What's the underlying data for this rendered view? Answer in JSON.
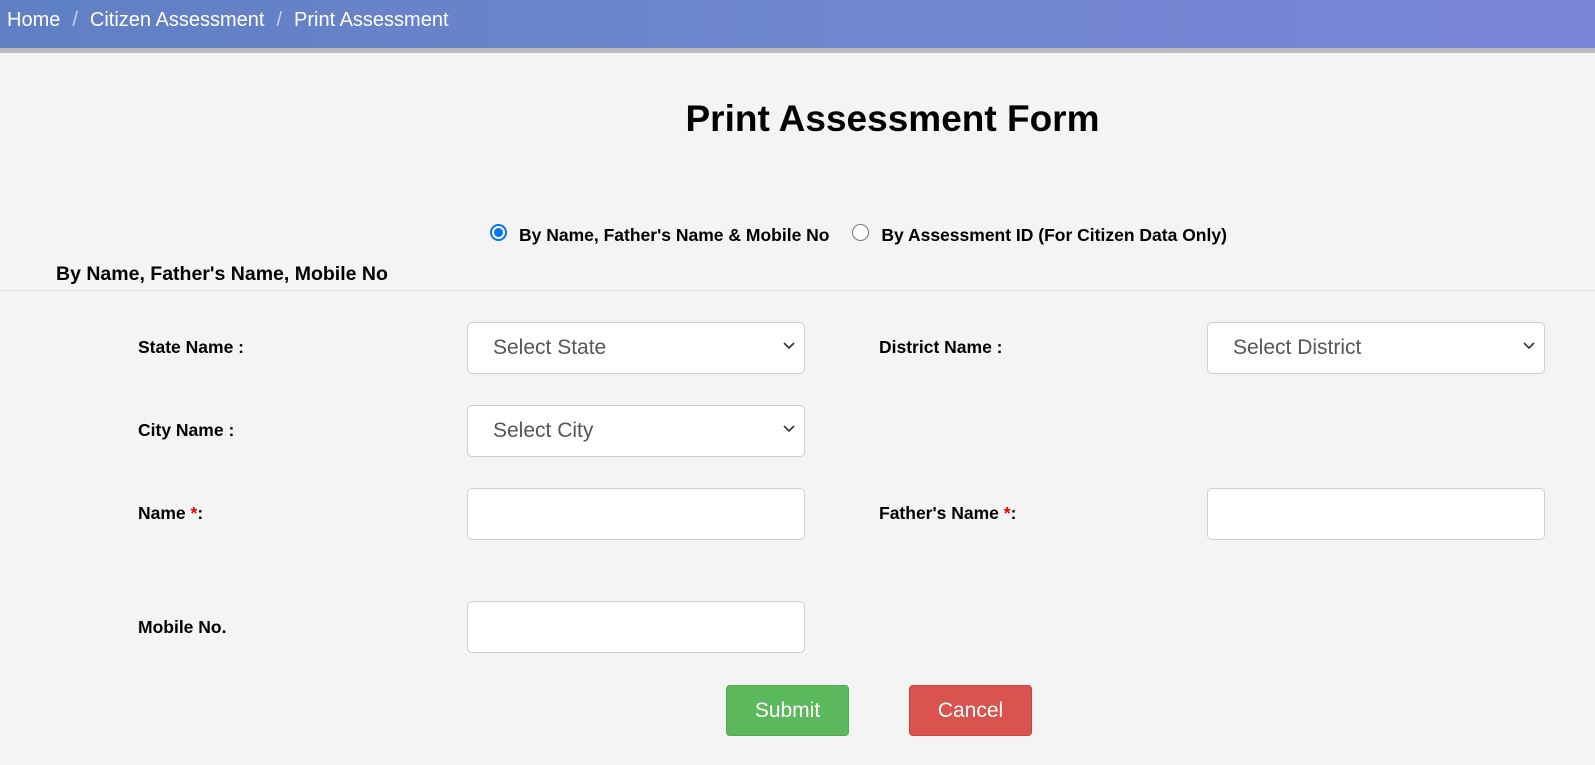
{
  "breadcrumb": {
    "items": [
      "Home",
      "Citizen Assessment",
      "Print Assessment"
    ],
    "separator": "/"
  },
  "page": {
    "title": "Print Assessment Form"
  },
  "search_mode": {
    "options": [
      {
        "label": "By Name, Father's Name & Mobile No",
        "checked": true
      },
      {
        "label": "By Assessment ID (For Citizen Data Only)",
        "checked": false
      }
    ]
  },
  "section": {
    "title": "By Name, Father's Name, Mobile No"
  },
  "form": {
    "state": {
      "label": "State Name :",
      "value": "Select State"
    },
    "district": {
      "label": "District Name :",
      "value": "Select District"
    },
    "city": {
      "label": "City Name :",
      "value": "Select City"
    },
    "name": {
      "label": "Name ",
      "required_mark": "*",
      "suffix": ":",
      "value": ""
    },
    "father_name": {
      "label": "Father's Name ",
      "required_mark": "*",
      "suffix": ":",
      "value": ""
    },
    "mobile": {
      "label": "Mobile No.",
      "value": ""
    }
  },
  "buttons": {
    "submit": "Submit",
    "cancel": "Cancel"
  },
  "colors": {
    "header_start": "#5f7fc4",
    "header_end": "#7b86d8",
    "submit": "#5cb85c",
    "cancel": "#d9534f",
    "required": "#ee0000",
    "radio_accent": "#0075ff"
  },
  "icons": {
    "select_chevron": "chevron-down-icon"
  }
}
